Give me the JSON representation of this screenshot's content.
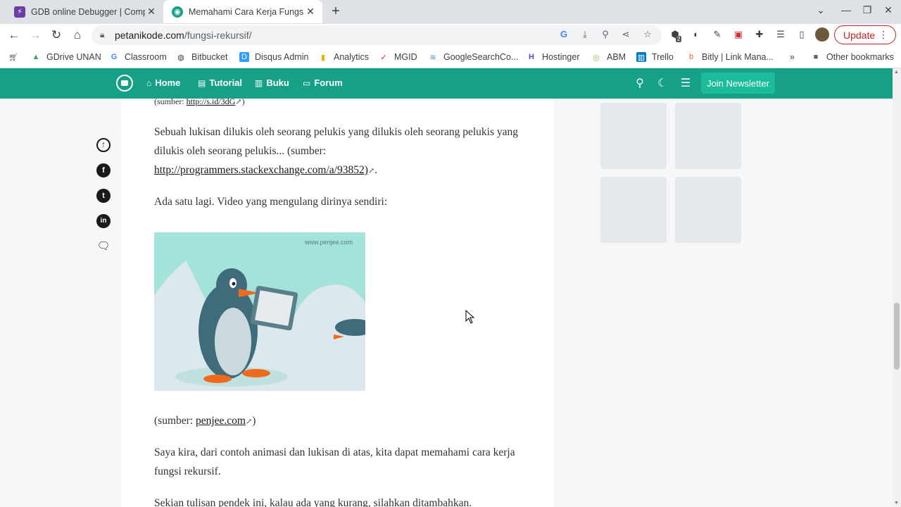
{
  "browser": {
    "tabs": [
      {
        "title": "GDB online Debugger | Compiler",
        "favicon_color": "#6a3ea1",
        "active": false
      },
      {
        "title": "Memahami Cara Kerja Fungsi Rekursif",
        "favicon_color": "#16a085",
        "active": true
      }
    ],
    "url_domain": "petanikode.com",
    "url_path": "/fungsi-rekursif/",
    "update_label": "Update",
    "extension_badge": "2"
  },
  "bookmarks": [
    {
      "label": "GDrive UNAN",
      "icon": "drive-icon"
    },
    {
      "label": "Classroom",
      "icon": "google-icon"
    },
    {
      "label": "Bitbucket",
      "icon": "globe-icon"
    },
    {
      "label": "Disqus Admin",
      "icon": "disqus-icon"
    },
    {
      "label": "Analytics",
      "icon": "analytics-icon"
    },
    {
      "label": "MGID",
      "icon": "mgid-icon"
    },
    {
      "label": "GoogleSearchCo...",
      "icon": "search-console-icon"
    },
    {
      "label": "Hostinger",
      "icon": "hostinger-icon"
    },
    {
      "label": "ABM",
      "icon": "abm-icon"
    },
    {
      "label": "Trello",
      "icon": "trello-icon"
    },
    {
      "label": "Bitly | Link Mana...",
      "icon": "bitly-icon"
    }
  ],
  "bookmarks_more": "»",
  "other_bookmarks": "Other bookmarks",
  "site_nav": {
    "items": [
      "Home",
      "Tutorial",
      "Buku",
      "Forum"
    ],
    "join_label": "Join Newsletter"
  },
  "article": {
    "source_top_prefix": "(sumber: ",
    "source_top_link": "http://s.id/3dG",
    "source_top_suffix": ")",
    "p1": "Sebuah lukisan dilukis oleh seorang pelukis yang dilukis oleh seorang pelukis yang dilukis oleh seorang pelukis... (sumber:",
    "p1_link": "http://programmers.stackexchange.com/a/93852)",
    "p1_suffix": ".",
    "p2": "Ada satu lagi. Video yang mengulang dirinya sendiri:",
    "image_watermark": "www.penjee.com",
    "source2_prefix": "(sumber: ",
    "source2_link": "penjee.com",
    "source2_suffix": ")",
    "p3": "Saya kira, dari contoh animasi dan lukisan di atas, kita dapat memahami cara kerja fungsi rekursif.",
    "p4": "Sekian tulisan pendek ini, kalau ada yang kurang, silahkan ditambahkan."
  },
  "colors": {
    "brand": "#16a085",
    "join_button": "#1bbc9b",
    "update_red": "#c5221f"
  }
}
